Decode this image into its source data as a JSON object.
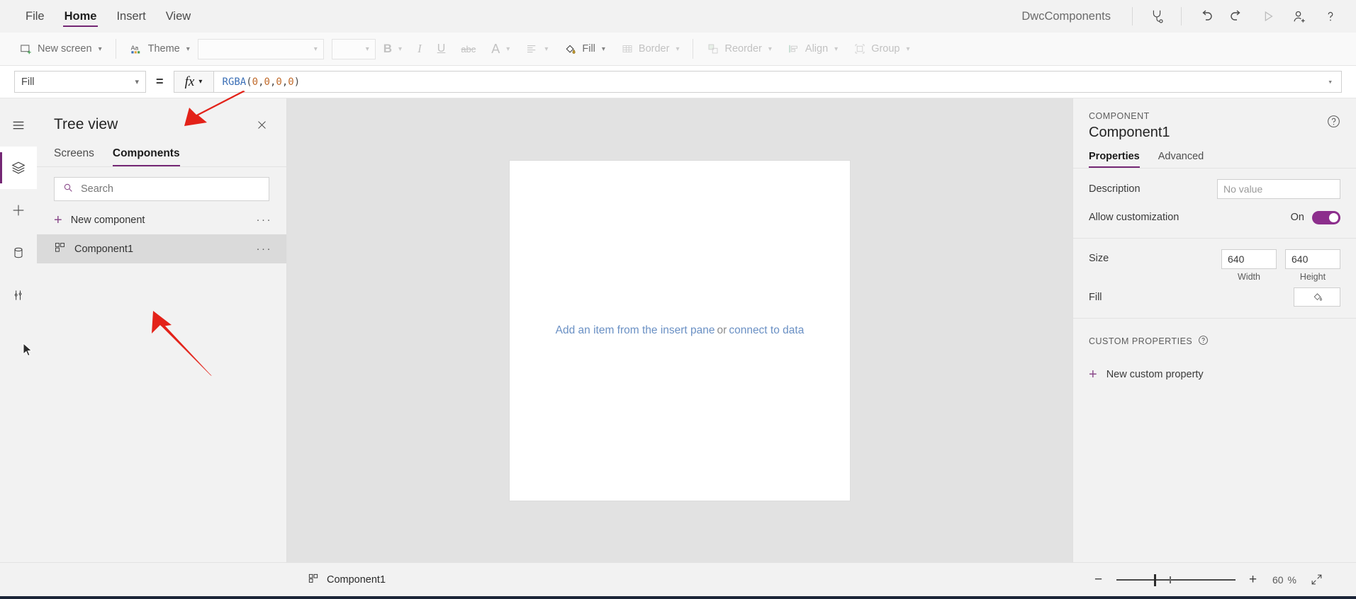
{
  "menubar": {
    "items": [
      {
        "label": "File",
        "active": false
      },
      {
        "label": "Home",
        "active": true
      },
      {
        "label": "Insert",
        "active": false
      },
      {
        "label": "View",
        "active": false
      }
    ],
    "app_title": "DwcComponents",
    "actions": [
      {
        "name": "app-checker-icon",
        "label": "App checker"
      },
      {
        "name": "undo-icon",
        "label": "Undo"
      },
      {
        "name": "redo-icon",
        "label": "Redo"
      },
      {
        "name": "preview-icon",
        "label": "Preview the app"
      },
      {
        "name": "share-icon",
        "label": "Share"
      },
      {
        "name": "help-icon",
        "label": "Help"
      }
    ]
  },
  "ribbon": {
    "new_screen": "New screen",
    "theme": "Theme",
    "font_value": "",
    "font_size_value": "",
    "bold": "B",
    "italic": "I",
    "underline": "U",
    "strikethrough": "abc",
    "font_color": "A",
    "align": "align",
    "fill": "Fill",
    "border": "Border",
    "reorder": "Reorder",
    "align_label": "Align",
    "group": "Group"
  },
  "formulabar": {
    "property": "Fill",
    "equals": "=",
    "fx": "fx",
    "formula_fn": "RGBA",
    "formula_open": "(",
    "formula_args": [
      "0",
      "0",
      "0",
      "0"
    ],
    "formula_sep": ", ",
    "formula_close": ")",
    "formula_full": "RGBA(0, 0, 0, 0)"
  },
  "rail": {
    "items": [
      {
        "name": "hamburger-menu-icon",
        "label": "Menu",
        "active": false
      },
      {
        "name": "tree-view-icon",
        "label": "Tree view",
        "active": true
      },
      {
        "name": "insert-icon",
        "label": "Insert",
        "active": false
      },
      {
        "name": "data-icon",
        "label": "Data",
        "active": false
      },
      {
        "name": "advanced-tools-icon",
        "label": "Advanced tools",
        "active": false
      }
    ]
  },
  "treeview": {
    "title": "Tree view",
    "close_label": "Close",
    "tabs": [
      {
        "label": "Screens",
        "active": false
      },
      {
        "label": "Components",
        "active": true
      }
    ],
    "search_placeholder": "Search",
    "search_value": "",
    "rows": [
      {
        "label": "New component",
        "icon": "plus-icon",
        "selected": false,
        "menu": "···"
      },
      {
        "label": "Component1",
        "icon": "component-icon",
        "selected": true,
        "menu": "···"
      }
    ]
  },
  "canvas": {
    "hint_prefix": "Add an item from the insert pane",
    "hint_or": "or",
    "hint_suffix": "connect to data"
  },
  "properties": {
    "kicker": "COMPONENT",
    "name": "Component1",
    "help_label": "Help",
    "tabs": [
      {
        "label": "Properties",
        "active": true
      },
      {
        "label": "Advanced",
        "active": false
      }
    ],
    "description_label": "Description",
    "description_placeholder": "No value",
    "description_value": "",
    "allow_customization_label": "Allow customization",
    "allow_customization_state": "On",
    "size_label": "Size",
    "width_value": "640",
    "width_caption": "Width",
    "height_value": "640",
    "height_caption": "Height",
    "fill_label": "Fill",
    "fill_icon": "paint-bucket-icon",
    "custom_properties_header": "CUSTOM PROPERTIES",
    "new_custom_property": "New custom property"
  },
  "statusbar": {
    "selection_label": "Component1",
    "zoom_out": "−",
    "zoom_in": "+",
    "zoom_value": "60",
    "zoom_unit": "%",
    "fit_label": "Fit to screen"
  },
  "colors": {
    "accent": "#742774",
    "toggle_on": "#8c2e8c",
    "link": "#6a90c4",
    "annotation_arrow": "#e32219",
    "canvas_bg": "#e2e2e2",
    "panel_bg": "#f2f2f2"
  }
}
